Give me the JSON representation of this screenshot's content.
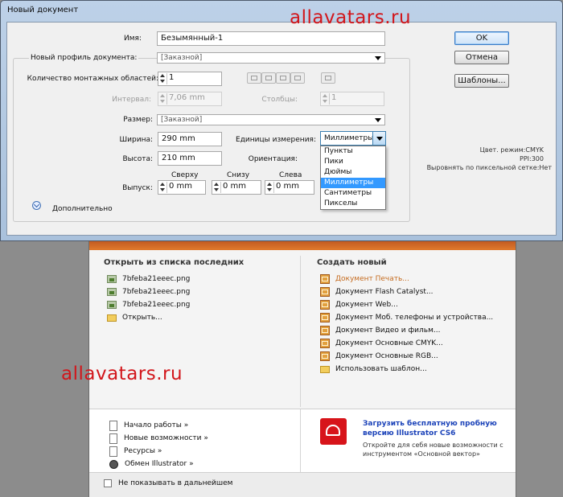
{
  "watermark_text": "allavatars.ru",
  "dialog": {
    "title": "Новый документ",
    "name_label": "Имя:",
    "name_value": "Безымянный-1",
    "profile_label": "Новый профиль документа:",
    "profile_value": "[Заказной]",
    "artboards_label": "Количество монтажных областей:",
    "artboards_value": "1",
    "spacing_label": "Интервал:",
    "spacing_value": "7,06 mm",
    "columns_label": "Столбцы:",
    "columns_value": "1",
    "size_label": "Размер:",
    "size_value": "[Заказной]",
    "width_label": "Ширина:",
    "width_value": "290 mm",
    "units_label": "Единицы измерения:",
    "units_value": "Миллиметры",
    "height_label": "Высота:",
    "height_value": "210 mm",
    "orientation_label": "Ориентация:",
    "bleed_label": "Выпуск:",
    "bleed_top_label": "Сверху",
    "bleed_top_value": "0 mm",
    "bleed_bottom_label": "Снизу",
    "bleed_bottom_value": "0 mm",
    "bleed_left_label": "Слева",
    "bleed_left_value": "0 mm",
    "advanced_label": "Дополнительно",
    "ok_label": "OK",
    "cancel_label": "Отмена",
    "templates_label": "Шаблоны...",
    "info_color_mode": "Цвет. режим:CMYK",
    "info_ppi": "PPI:300",
    "info_pixel_grid": "Выровнять по пиксельной сетке:Нет",
    "units_options": [
      "Пункты",
      "Пики",
      "Дюймы",
      "Миллиметры",
      "Сантиметры",
      "Пикселы"
    ],
    "units_selected_index": 3
  },
  "welcome": {
    "recent_title": "Открыть из списка последних",
    "recent_files": [
      "7bfeba21eeec.png",
      "7bfeba21eeec.png",
      "7bfeba21eeec.png"
    ],
    "open_label": "Открыть...",
    "create_title": "Создать новый",
    "create_items": [
      "Документ Печать...",
      "Документ Flash Catalyst...",
      "Документ Web...",
      "Документ Моб. телефоны и устройства...",
      "Документ Видео и фильм...",
      "Документ Основные CMYK...",
      "Документ Основные RGB...",
      "Использовать шаблон..."
    ],
    "links": [
      "Начало работы »",
      "Новые возможности »",
      "Ресурсы »",
      "Обмен Illustrator »"
    ],
    "promo_title_line1": "Загрузить бесплатную пробную",
    "promo_title_line2": "версию Illustrator CS6",
    "promo_text_line1": "Откройте для себя новые возможности с",
    "promo_text_line2": "инструментом «Основной вектор»",
    "dont_show_label": "Не показывать в дальнейшем"
  },
  "colors": {
    "watermark": "#d2161b",
    "welcome_accent": "#c56b1f",
    "promo_link": "#1c43b9",
    "selection": "#3399ff"
  }
}
